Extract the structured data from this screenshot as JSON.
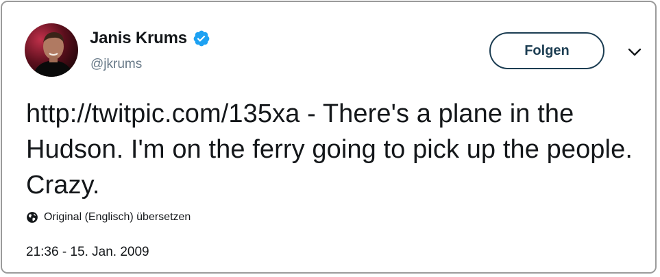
{
  "author": {
    "name": "Janis Krums",
    "handle": "@jkrums",
    "verified": true
  },
  "actions": {
    "follow_label": "Folgen",
    "more_icon": "chevron-down-icon"
  },
  "tweet": {
    "text": "http://twitpic.com/135xa - There's a plane in the Hudson. I'm on the ferry going to pick up the people. Crazy.",
    "translate_label": "Original (Englisch) übersetzen",
    "timestamp": "21:36 - 15. Jan. 2009"
  },
  "colors": {
    "verified": "#1da1f2",
    "follow_border": "#1c3d52",
    "handle": "#657786",
    "border": "#9b9b9b"
  }
}
